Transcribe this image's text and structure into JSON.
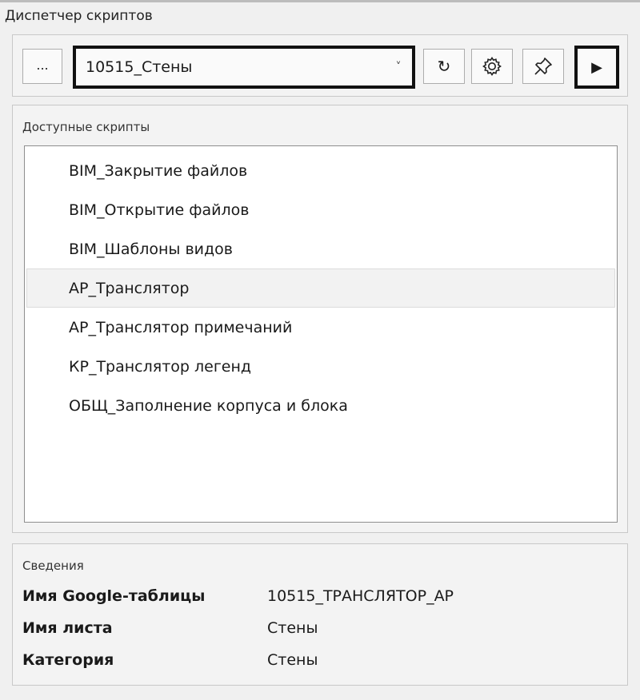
{
  "window": {
    "title": "Диспетчер скриптов"
  },
  "toolbar": {
    "browse_label": "...",
    "selected_table": "10515_Стены",
    "dropdown_glyph": "˅",
    "refresh_glyph": "↻",
    "run_glyph": "▶",
    "icons": [
      "refresh-icon",
      "gear-icon",
      "pin-icon",
      "play-icon"
    ]
  },
  "scripts": {
    "group_label": "Доступные скрипты",
    "selected_index": 3,
    "items": [
      {
        "label": "BIM_Закрытие файлов"
      },
      {
        "label": "BIM_Открытие файлов"
      },
      {
        "label": "BIM_Шаблоны видов"
      },
      {
        "label": "АР_Транслятор"
      },
      {
        "label": "АР_Транслятор примечаний"
      },
      {
        "label": "КР_Транслятор легенд"
      },
      {
        "label": "ОБЩ_Заполнение корпуса и блока"
      }
    ]
  },
  "info": {
    "group_label": "Сведения",
    "rows": [
      {
        "key": "Имя Google-таблицы",
        "value": "10515_ТРАНСЛЯТОР_АР"
      },
      {
        "key": "Имя листа",
        "value": "Стены"
      },
      {
        "key": "Категория",
        "value": "Стены"
      }
    ]
  },
  "colors": {
    "panel_bg": "#f0f0f0",
    "highlight_border": "#111111",
    "selected_row_bg": "#f2f2f2"
  }
}
